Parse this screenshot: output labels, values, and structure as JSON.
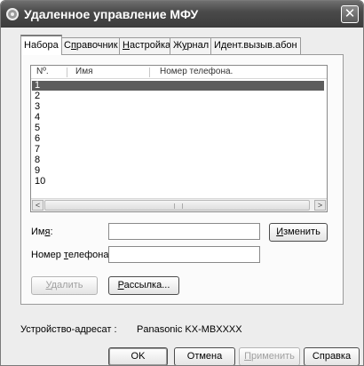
{
  "window": {
    "title": "Удаленное управление МФУ",
    "close_glyph": "✕"
  },
  "tabs": [
    {
      "label": "Набора",
      "active": true
    },
    {
      "label_pre": "С",
      "label_u": "п",
      "label_post": "равочник"
    },
    {
      "label_pre": "",
      "label_u": "Н",
      "label_post": "астройка"
    },
    {
      "label_pre": "Ж",
      "label_u": "у",
      "label_post": "рнал"
    },
    {
      "label_pre": "Идент.вызыв.абон",
      "label_u": "",
      "label_post": ""
    }
  ],
  "list": {
    "columns": [
      "Nº.",
      "Имя",
      "Номер телефона."
    ],
    "rows": [
      "1",
      "2",
      "3",
      "4",
      "5",
      "6",
      "7",
      "8",
      "9",
      "10"
    ],
    "selected_index": 0,
    "scroll_left": "<",
    "scroll_right": ">"
  },
  "form": {
    "name_label_pre": "Им",
    "name_label_u": "я",
    "name_label_post": ":",
    "name_value": "",
    "phone_label_pre": "Номер ",
    "phone_label_u": "т",
    "phone_label_post": "елефона.:",
    "phone_value": "",
    "change_pre": "",
    "change_u": "И",
    "change_post": "зменить",
    "delete_pre": "",
    "delete_u": "У",
    "delete_post": "далить",
    "broadcast_pre": "",
    "broadcast_u": "Р",
    "broadcast_post": "ассылка..."
  },
  "device": {
    "label": "Устройство-адресат :",
    "value": "Panasonic KX-MBXXXX"
  },
  "footer": {
    "ok": "OK",
    "cancel": "Отмена",
    "apply_pre": "",
    "apply_u": "П",
    "apply_post": "рименить",
    "help": "Справка"
  },
  "colors": {
    "titlebar": "#3c3c3c",
    "selection": "#5d5d5d",
    "window_bg": "#ededed"
  }
}
